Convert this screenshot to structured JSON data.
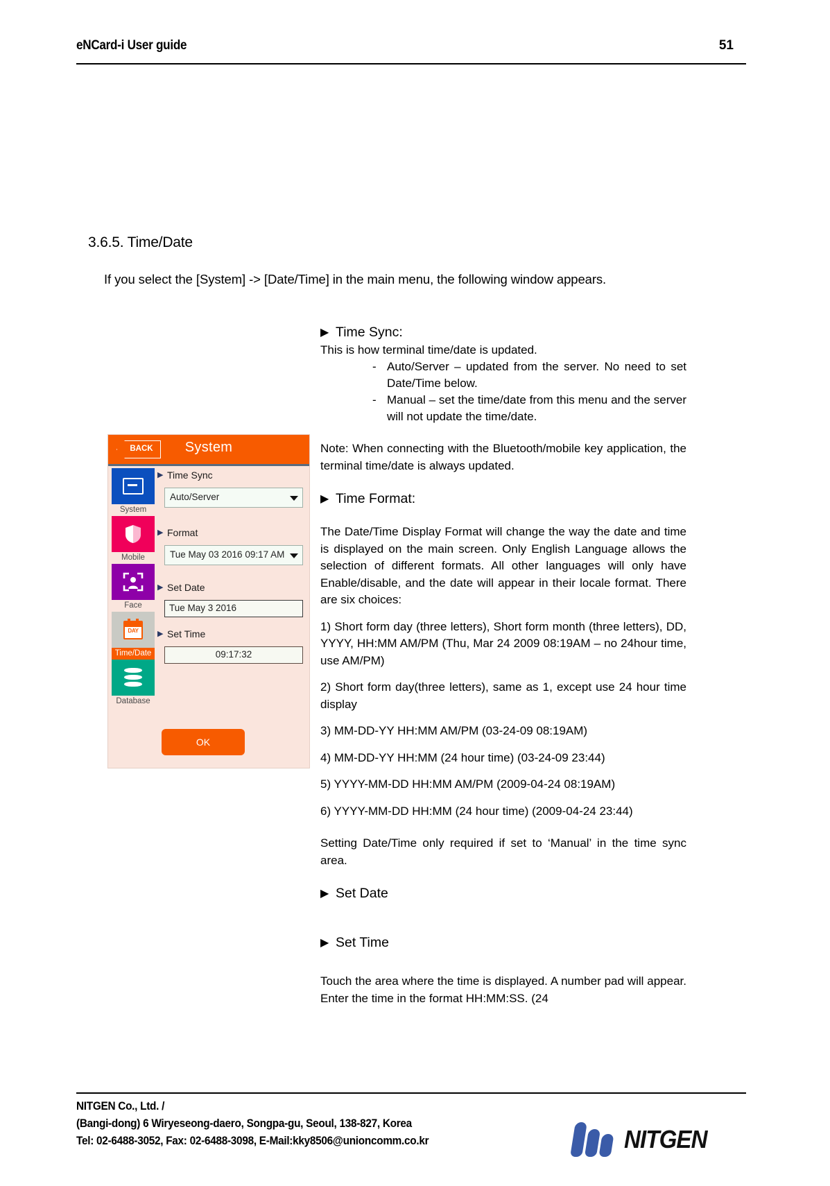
{
  "header": {
    "doc_title": "eNCard-i User guide",
    "page_number": "51"
  },
  "section": {
    "heading": "3.6.5. Time/Date",
    "intro": "If you select the [System] -> [Date/Time] in the main menu, the following window appears."
  },
  "device": {
    "back_label": "BACK",
    "title": "System",
    "sidebar": [
      {
        "label": "System",
        "icon": "window-icon",
        "color": "#0b4fbe",
        "active": false
      },
      {
        "label": "Mobile",
        "icon": "shield-icon",
        "color": "#f0005a",
        "active": false
      },
      {
        "label": "Face",
        "icon": "face-scan-icon",
        "color": "#8e00a8",
        "active": false
      },
      {
        "label": "Time/Date",
        "icon": "calendar-icon",
        "color": "#c9cac4",
        "active": true
      },
      {
        "label": "Database",
        "icon": "database-icon",
        "color": "#00a887",
        "active": false
      }
    ],
    "fields": {
      "time_sync_label": "Time Sync",
      "time_sync_value": "Auto/Server",
      "format_label": "Format",
      "format_value": "Tue May 03 2016 09:17 AM",
      "set_date_label": "Set  Date",
      "set_date_value": "Tue May 3 2016",
      "set_time_label": "Set Time",
      "set_time_value": "09:17:32"
    },
    "ok_label": "OK",
    "accent_color": "#f75b00"
  },
  "content": {
    "time_sync_heading": "Time Sync:",
    "time_sync_intro": "This is how terminal time/date is updated.",
    "time_sync_items": [
      "Auto/Server – updated from the server. No need to set Date/Time below.",
      "Manual – set the time/date from this menu and the server will not update the time/date."
    ],
    "note": "Note: When connecting with the Bluetooth/mobile key application, the terminal time/date is always updated.",
    "time_format_heading": "Time Format:",
    "time_format_para": "The Date/Time Display Format will change the way the date and time is displayed on the main screen. Only English Language allows the selection of different formats. All other languages will only have Enable/disable, and the date will appear in their locale format. There are six choices:",
    "format_choices": [
      "1) Short form day (three letters), Short form month (three letters), DD, YYYY, HH:MM AM/PM (Thu, Mar 24 2009 08:19AM – no 24hour time, use AM/PM)",
      "2) Short form day(three letters), same as 1, except use 24 hour time display",
      "3) MM-DD-YY HH:MM AM/PM (03-24-09 08:19AM)",
      "4) MM-DD-YY HH:MM (24 hour time) (03-24-09 23:44)",
      "5) YYYY-MM-DD HH:MM AM/PM (2009-04-24 08:19AM)",
      "6) YYYY-MM-DD HH:MM (24 hour time) (2009-04-24 23:44)"
    ],
    "manual_note": "Setting Date/Time only required if set to ‘Manual’ in the time sync area.",
    "set_date_heading": "Set Date",
    "set_time_heading": "Set Time",
    "set_time_para": "Touch the area where the time is displayed. A number pad will appear. Enter the time in the format HH:MM:SS. (24",
    "bullet_glyph": "▶"
  },
  "footer": {
    "line1": "NITGEN Co., Ltd. /",
    "line2": "(Bangi-dong) 6 Wiryeseong-daero, Songpa-gu, Seoul, 138-827, Korea",
    "line3": "Tel: 02-6488-3052, Fax: 02-6488-3098, E-Mail:kky8506@unioncomm.co.kr",
    "logo_text": "NITGEN"
  }
}
